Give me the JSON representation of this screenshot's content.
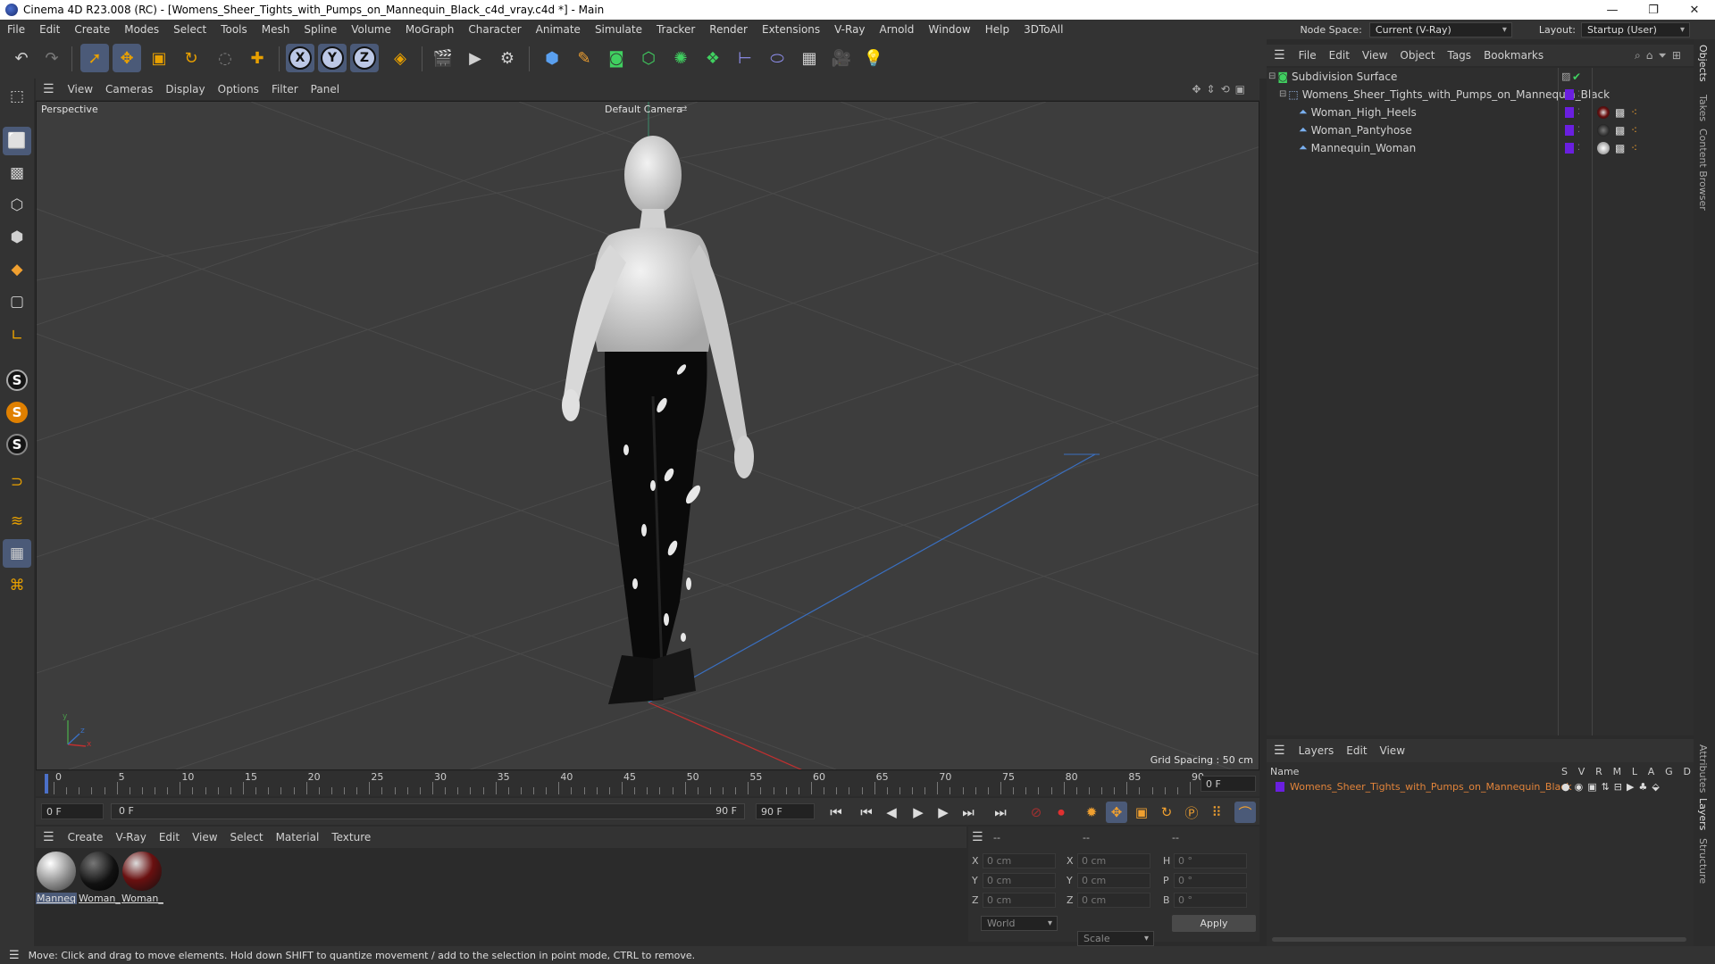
{
  "window": {
    "title": "Cinema 4D R23.008 (RC) - [Womens_Sheer_Tights_with_Pumps_on_Mannequin_Black_c4d_vray.c4d *] - Main",
    "minimize": "—",
    "maximize": "❐",
    "close": "✕"
  },
  "menubar": {
    "items": [
      "File",
      "Edit",
      "Create",
      "Modes",
      "Select",
      "Tools",
      "Mesh",
      "Spline",
      "Volume",
      "MoGraph",
      "Character",
      "Animate",
      "Simulate",
      "Tracker",
      "Render",
      "Extensions",
      "V-Ray",
      "Arnold",
      "Window",
      "Help",
      "3DToAll"
    ],
    "node_space_label": "Node Space:",
    "node_space_value": "Current (V-Ray)",
    "layout_label": "Layout:",
    "layout_value": "Startup (User)"
  },
  "toolbar": {
    "axis_x": "X",
    "axis_y": "Y",
    "axis_z": "Z"
  },
  "viewport": {
    "menu": [
      "View",
      "Cameras",
      "Display",
      "Options",
      "Filter",
      "Panel"
    ],
    "mode_label": "Perspective",
    "camera_label": "Default Camera",
    "grid_spacing": "Grid Spacing : 50 cm",
    "axis_y": "y",
    "axis_z": "z",
    "axis_x": "x"
  },
  "timeline": {
    "ticks": [
      "0",
      "5",
      "10",
      "15",
      "20",
      "25",
      "30",
      "35",
      "40",
      "45",
      "50",
      "55",
      "60",
      "65",
      "70",
      "75",
      "80",
      "85",
      "90"
    ],
    "current_frame_right": "0 F",
    "start_field": "0 F",
    "range_start": "0 F",
    "range_end": "90 F",
    "end_field": "90 F"
  },
  "materials": {
    "menu": [
      "Create",
      "V-Ray",
      "Edit",
      "View",
      "Select",
      "Material",
      "Texture"
    ],
    "items": [
      {
        "label": "Manneq"
      },
      {
        "label": "Woman_"
      },
      {
        "label": "Woman_"
      }
    ]
  },
  "coordinates": {
    "headers": [
      "--",
      "--",
      "--"
    ],
    "rows": [
      {
        "l1": "X",
        "v1": "0 cm",
        "l2": "X",
        "v2": "0 cm",
        "l3": "H",
        "v3": "0 °"
      },
      {
        "l1": "Y",
        "v1": "0 cm",
        "l2": "Y",
        "v2": "0 cm",
        "l3": "P",
        "v3": "0 °"
      },
      {
        "l1": "Z",
        "v1": "0 cm",
        "l2": "Z",
        "v2": "0 cm",
        "l3": "B",
        "v3": "0 °"
      }
    ],
    "space": "World",
    "mode": "Scale",
    "apply": "Apply"
  },
  "objects": {
    "menu": [
      "File",
      "Edit",
      "View",
      "Object",
      "Tags",
      "Bookmarks"
    ],
    "items": [
      {
        "name": "Subdivision Surface"
      },
      {
        "name": "Womens_Sheer_Tights_with_Pumps_on_Mannequin_Black"
      },
      {
        "name": "Woman_High_Heels"
      },
      {
        "name": "Woman_Pantyhose"
      },
      {
        "name": "Mannequin_Woman"
      }
    ]
  },
  "layers": {
    "menu": [
      "Layers",
      "Edit",
      "View"
    ],
    "name_header": "Name",
    "flags": [
      "S",
      "V",
      "R",
      "M",
      "L",
      "A",
      "G",
      "D"
    ],
    "row_name": "Womens_Sheer_Tights_with_Pumps_on_Mannequin_Black"
  },
  "side_tabs": [
    "Objects",
    "Takes",
    "Content Browser",
    "Attributes",
    "Layers",
    "Structure"
  ],
  "status": "Move: Click and drag to move elements. Hold down SHIFT to quantize movement / add to the selection in point mode, CTRL to remove.",
  "colors": {
    "accent": "#4b5a78",
    "layer": "#6a1fe0",
    "layer_text": "#e2843a",
    "axis_x": "#c03030",
    "axis_y": "#4a9a4a",
    "axis_z": "#3a6fc0"
  }
}
